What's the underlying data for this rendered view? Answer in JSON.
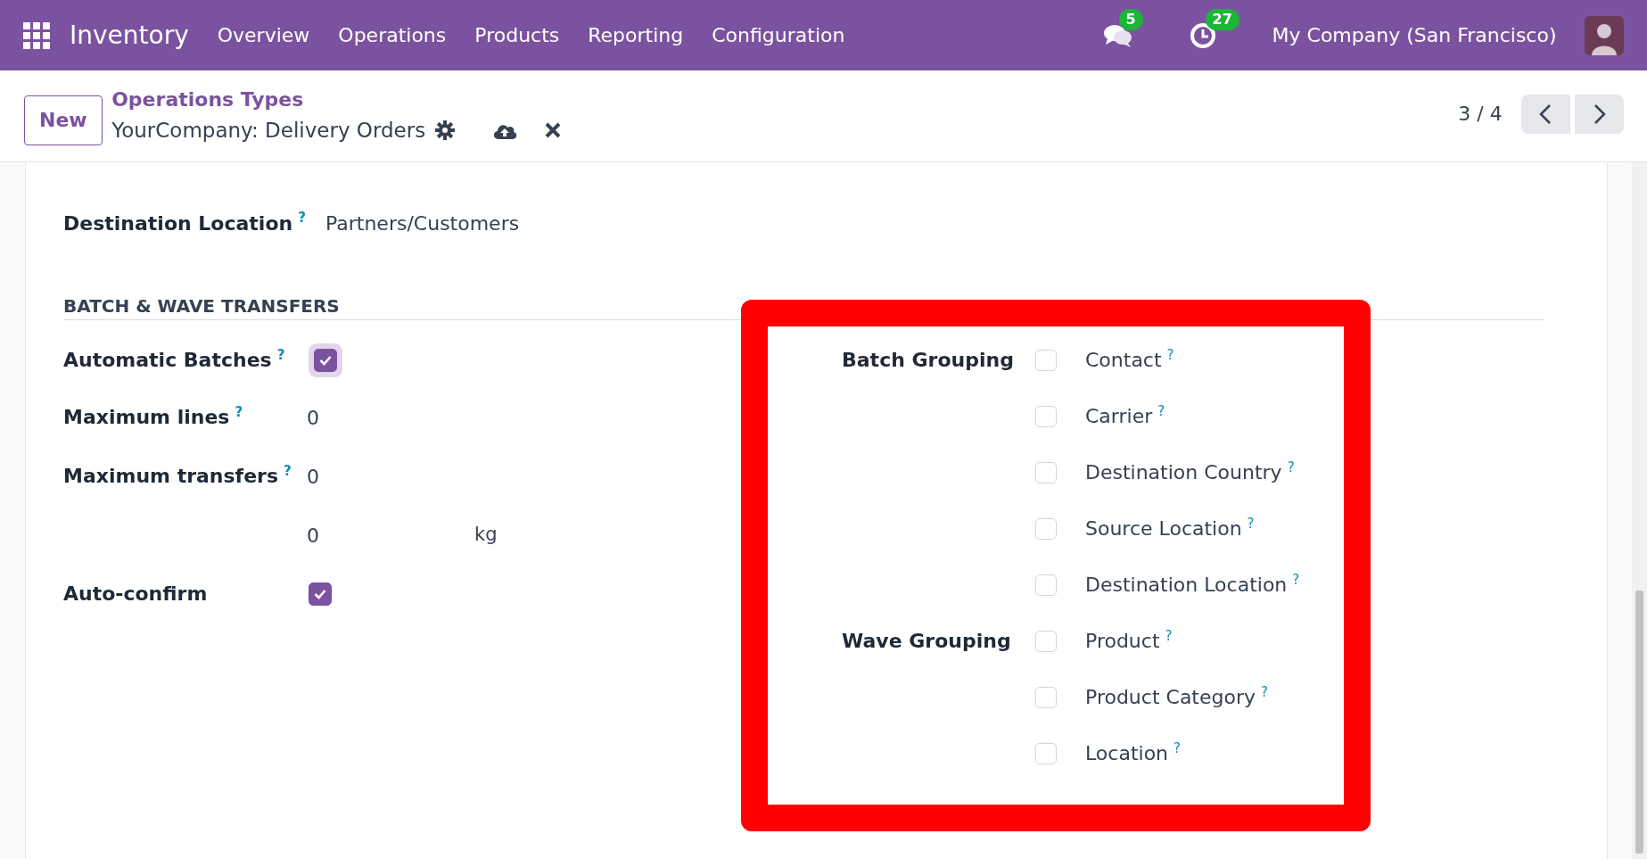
{
  "navbar": {
    "app_name": "Inventory",
    "menu": [
      "Overview",
      "Operations",
      "Products",
      "Reporting",
      "Configuration"
    ],
    "messages_count": "5",
    "activities_count": "27",
    "company": "My Company (San Francisco)"
  },
  "control_panel": {
    "new_button": "New",
    "breadcrumb": "Operations Types",
    "record_title": "YourCompany: Delivery Orders",
    "pager": "3 / 4"
  },
  "destination": {
    "label": "Destination Location",
    "help": "?",
    "value": "Partners/Customers"
  },
  "section": {
    "title": "BATCH & WAVE TRANSFERS",
    "left_fields": [
      {
        "kind": "checkbox",
        "label": "Automatic Batches",
        "help": "?",
        "checked": true,
        "focused": true
      },
      {
        "kind": "number",
        "label": "Maximum lines",
        "help": "?",
        "value": "0"
      },
      {
        "kind": "number",
        "label": "Maximum transfers",
        "help": "?",
        "value": "0"
      },
      {
        "kind": "number",
        "value": "0",
        "unit": "kg"
      },
      {
        "kind": "checkbox",
        "label": "Auto-confirm",
        "checked": true,
        "focused": false
      }
    ],
    "groups": [
      {
        "label": "Batch Grouping",
        "options": [
          {
            "label": "Contact",
            "help": "?",
            "checked": false
          },
          {
            "label": "Carrier",
            "help": "?",
            "checked": false
          },
          {
            "label": "Destination Country",
            "help": "?",
            "checked": false
          },
          {
            "label": "Source Location",
            "help": "?",
            "checked": false
          },
          {
            "label": "Destination Location",
            "help": "?",
            "checked": false
          }
        ]
      },
      {
        "label": "Wave Grouping",
        "options": [
          {
            "label": "Product",
            "help": "?",
            "checked": false
          },
          {
            "label": "Product Category",
            "help": "?",
            "checked": false
          },
          {
            "label": "Location",
            "help": "?",
            "checked": false
          }
        ]
      }
    ]
  }
}
